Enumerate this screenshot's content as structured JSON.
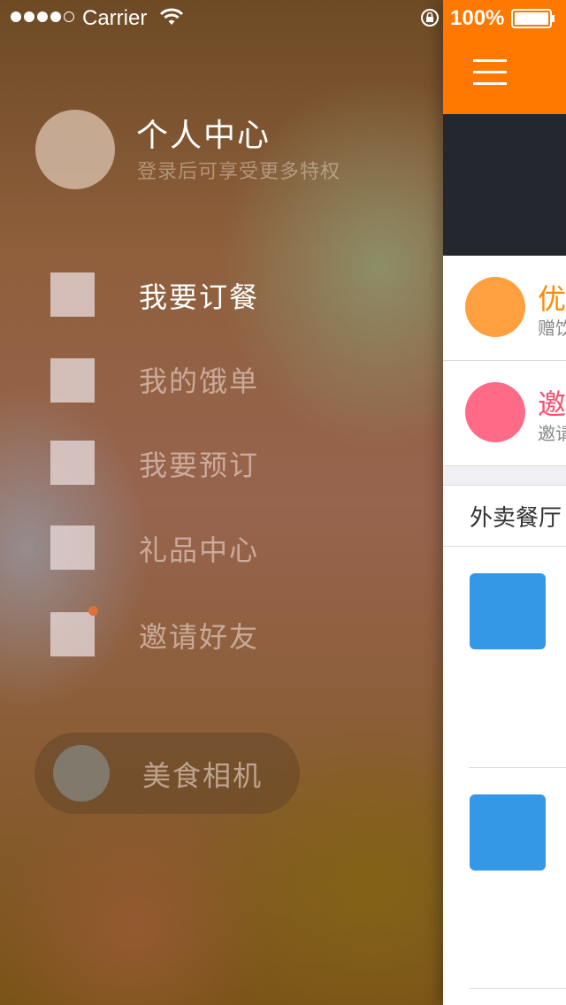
{
  "status_bar": {
    "carrier": "Carrier",
    "battery": "100%",
    "signal_filled": 4,
    "signal_total": 5
  },
  "profile": {
    "title": "个人中心",
    "subtitle": "登录后可享受更多特权"
  },
  "menu": {
    "items": [
      {
        "label": "我要订餐",
        "active": true
      },
      {
        "label": "我的饿单",
        "active": false
      },
      {
        "label": "我要预订",
        "active": false
      },
      {
        "label": "礼品中心",
        "active": false
      },
      {
        "label": "邀请好友",
        "active": false,
        "badge": true
      }
    ],
    "camera_label": "美食相机"
  },
  "main": {
    "promos": [
      {
        "title": "优",
        "subtitle": "赠饮",
        "color": "#ffa040",
        "title_color": "#ff8a00"
      },
      {
        "title": "邀",
        "subtitle": "邀请",
        "color": "#ff6b86",
        "title_color": "#ff4f6e"
      }
    ],
    "section_title": "外卖餐厅"
  },
  "colors": {
    "topbar": "#ff7800",
    "banner": "#24272e",
    "thumbnail": "#3498e6"
  }
}
